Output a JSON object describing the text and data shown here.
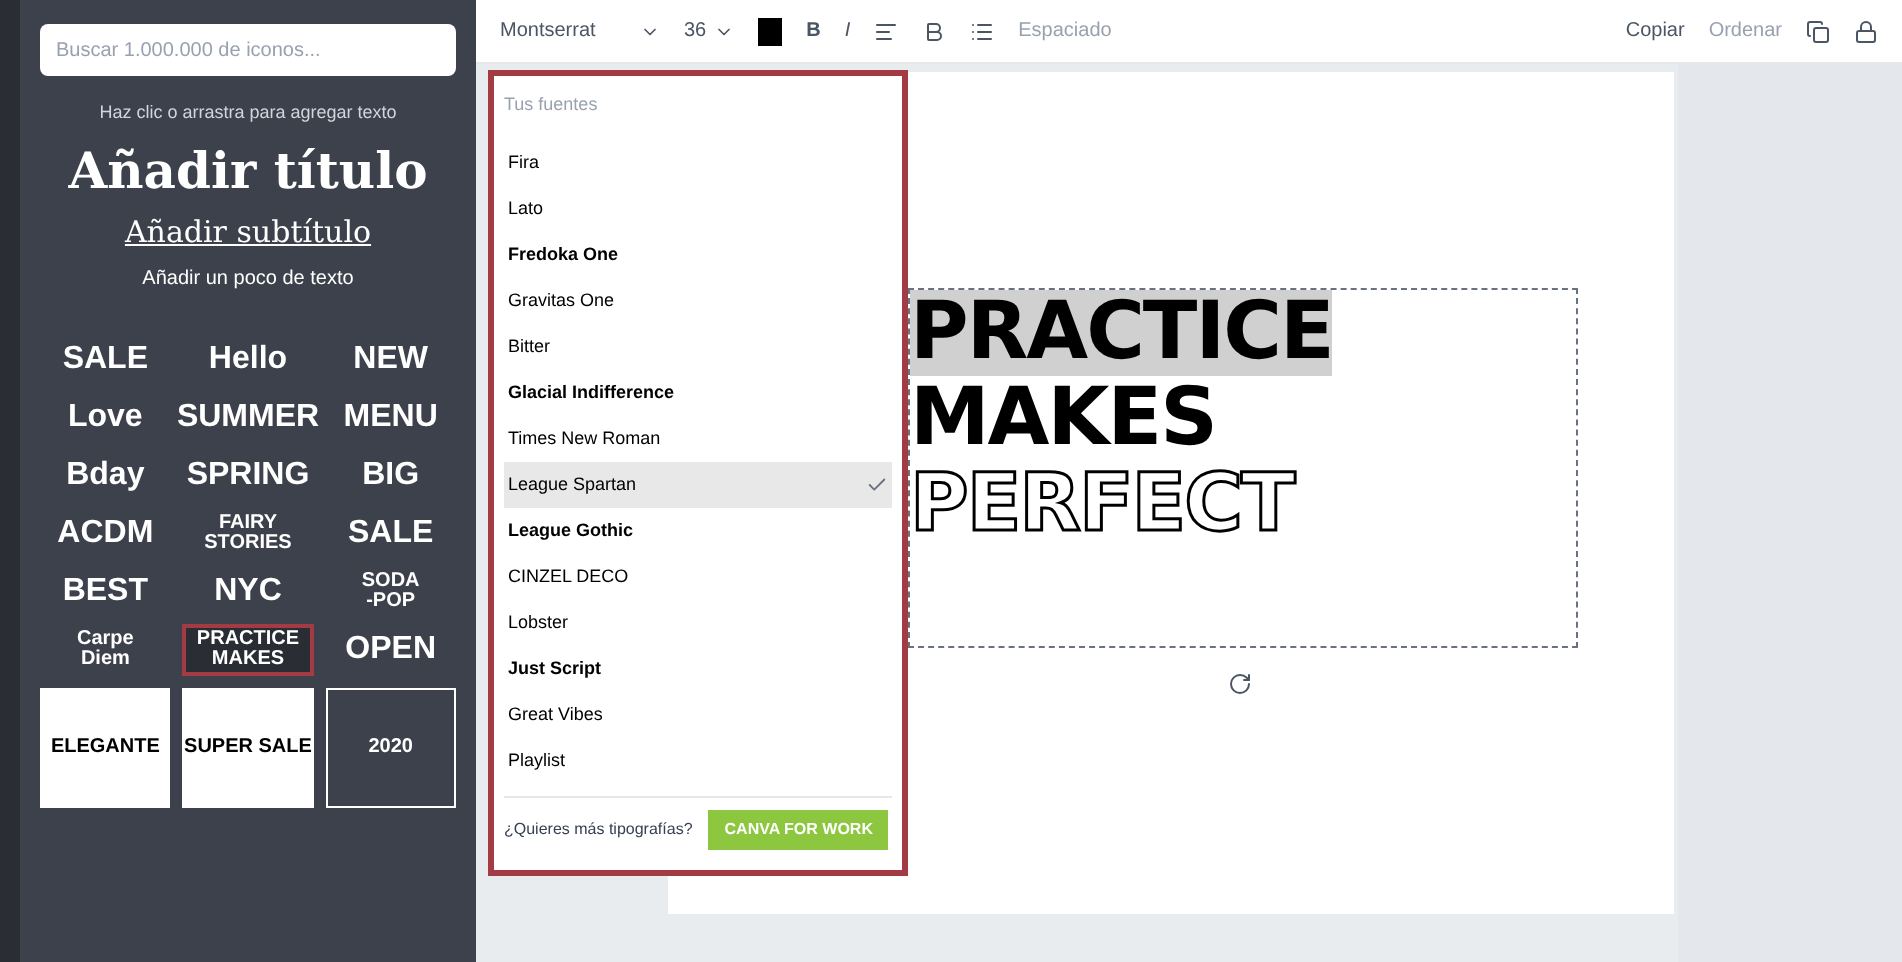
{
  "sidebar": {
    "search": {
      "placeholder": "Buscar 1.000.000 de iconos..."
    },
    "hint": "Haz clic o arrastra para agregar texto",
    "add_title": "Añadir título",
    "add_subtitle": "Añadir subtítulo",
    "add_body": "Añadir un poco de texto",
    "templates": [
      {
        "lines": [
          "SALE"
        ],
        "selected": false
      },
      {
        "lines": [
          "Hello"
        ],
        "selected": false
      },
      {
        "lines": [
          "NEW"
        ],
        "selected": false
      },
      {
        "lines": [
          "Love"
        ],
        "selected": false
      },
      {
        "lines": [
          "SUMMER"
        ],
        "selected": false
      },
      {
        "lines": [
          "MENU"
        ],
        "selected": false
      },
      {
        "lines": [
          "Bday"
        ],
        "selected": false
      },
      {
        "lines": [
          "SPRING"
        ],
        "selected": false
      },
      {
        "lines": [
          "BIG"
        ],
        "selected": false
      },
      {
        "lines": [
          "ACDM"
        ],
        "selected": false
      },
      {
        "lines": [
          "FAIRY",
          "STORIES"
        ],
        "selected": false
      },
      {
        "lines": [
          "SALE"
        ],
        "selected": false
      },
      {
        "lines": [
          "BEST"
        ],
        "selected": false
      },
      {
        "lines": [
          "NYC"
        ],
        "selected": false
      },
      {
        "lines": [
          "SODA",
          "-POP"
        ],
        "selected": false
      },
      {
        "lines": [
          "Carpe",
          "Diem"
        ],
        "selected": false
      },
      {
        "lines": [
          "PRACTICE",
          "MAKES"
        ],
        "selected": true
      },
      {
        "lines": [
          "OPEN"
        ],
        "selected": false
      }
    ],
    "cards": [
      {
        "text": "ELEGANTE"
      },
      {
        "text": "SUPER SALE"
      },
      {
        "text": "2020"
      }
    ]
  },
  "toolbar": {
    "font": "Montserrat",
    "size": "36",
    "buttons": [
      "B",
      "I"
    ],
    "spacing": "Espaciado",
    "copy": "Copiar",
    "arrange": "Ordenar"
  },
  "font_menu": {
    "section": "Tus fuentes",
    "fonts": [
      {
        "name": "Fira",
        "selected": false
      },
      {
        "name": "Lato",
        "selected": false
      },
      {
        "name": "Fredoka One",
        "selected": false
      },
      {
        "name": "Gravitas One",
        "selected": false
      },
      {
        "name": "Bitter",
        "selected": false
      },
      {
        "name": "Glacial Indifference",
        "selected": false
      },
      {
        "name": "Times New Roman",
        "selected": false
      },
      {
        "name": "League Spartan",
        "selected": true
      },
      {
        "name": "League Gothic",
        "selected": false
      },
      {
        "name": "CINZEL DECO",
        "selected": false
      },
      {
        "name": "Lobster",
        "selected": false
      },
      {
        "name": "Just Script",
        "selected": false
      },
      {
        "name": "Great Vibes",
        "selected": false
      },
      {
        "name": "Playlist",
        "selected": false
      }
    ],
    "more": "¿Quieres más tipografías?",
    "button": "CANVA FOR WORK"
  },
  "canvas": {
    "lines": [
      {
        "text": "PRACTICE",
        "kind": "solid",
        "highlighted": true
      },
      {
        "text": "MAKES",
        "kind": "solid",
        "highlighted": false
      },
      {
        "text": "PERFECT",
        "kind": "outline",
        "highlighted": false
      }
    ]
  }
}
